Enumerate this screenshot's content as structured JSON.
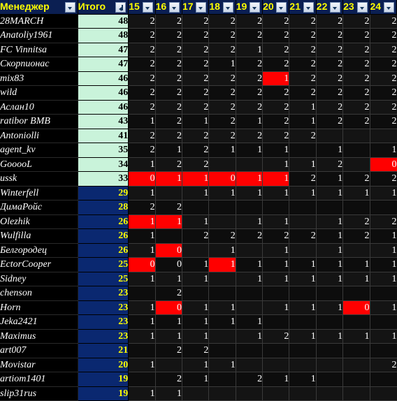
{
  "header": {
    "manager_label": "Менеджер",
    "total_label": "Итого",
    "filter_icon": "chevron-down-icon",
    "sort_icon": "sort-descending-icon",
    "round_columns": [
      "15",
      "16",
      "17",
      "18",
      "19",
      "20",
      "21",
      "22",
      "23",
      "24"
    ]
  },
  "colors": {
    "header_bg": "#0b1f52",
    "header_text": "#ffff00",
    "total_green": "#c9f3da",
    "total_blue": "#0a2870",
    "highlight_red": "#ff0000",
    "body_bg": "#000000"
  },
  "rows": [
    {
      "name": "28MARCH",
      "total": "48",
      "total_style": "green",
      "values": [
        "2",
        "2",
        "2",
        "2",
        "2",
        "2",
        "2",
        "2",
        "2",
        "2"
      ],
      "hot": []
    },
    {
      "name": "Anatoliy1961",
      "total": "48",
      "total_style": "green",
      "values": [
        "2",
        "2",
        "2",
        "2",
        "2",
        "2",
        "2",
        "2",
        "2",
        "2"
      ],
      "hot": []
    },
    {
      "name": "FC Vinnitsa",
      "total": "47",
      "total_style": "green",
      "values": [
        "2",
        "2",
        "2",
        "2",
        "1",
        "2",
        "2",
        "2",
        "2",
        "2"
      ],
      "hot": []
    },
    {
      "name": "Скорпионас",
      "total": "47",
      "total_style": "green",
      "values": [
        "2",
        "2",
        "2",
        "1",
        "2",
        "2",
        "2",
        "2",
        "2",
        "2"
      ],
      "hot": []
    },
    {
      "name": "mix83",
      "total": "46",
      "total_style": "green",
      "values": [
        "2",
        "2",
        "2",
        "2",
        "2",
        "1",
        "2",
        "2",
        "2",
        "2"
      ],
      "hot": [
        5
      ]
    },
    {
      "name": "wild",
      "total": "46",
      "total_style": "green",
      "values": [
        "2",
        "2",
        "2",
        "2",
        "2",
        "2",
        "2",
        "2",
        "2",
        "2"
      ],
      "hot": []
    },
    {
      "name": "Аслан10",
      "total": "46",
      "total_style": "green",
      "values": [
        "2",
        "2",
        "2",
        "2",
        "2",
        "2",
        "1",
        "2",
        "2",
        "2"
      ],
      "hot": []
    },
    {
      "name": "ratibor BMB",
      "total": "43",
      "total_style": "green",
      "values": [
        "1",
        "2",
        "1",
        "2",
        "1",
        "2",
        "1",
        "2",
        "2",
        "2"
      ],
      "hot": []
    },
    {
      "name": "Antoniolli",
      "total": "41",
      "total_style": "green",
      "values": [
        "2",
        "2",
        "2",
        "2",
        "2",
        "2",
        "2",
        "",
        "",
        ""
      ],
      "hot": []
    },
    {
      "name": "agent_kv",
      "total": "35",
      "total_style": "green",
      "values": [
        "2",
        "1",
        "2",
        "1",
        "1",
        "1",
        "",
        "1",
        "",
        "1"
      ],
      "hot": []
    },
    {
      "name": "GooooL",
      "total": "34",
      "total_style": "green",
      "values": [
        "1",
        "2",
        "2",
        "",
        "",
        "1",
        "1",
        "2",
        "",
        "0"
      ],
      "hot": [
        9
      ]
    },
    {
      "name": "ussk",
      "total": "33",
      "total_style": "green",
      "values": [
        "0",
        "1",
        "1",
        "0",
        "1",
        "1",
        "2",
        "1",
        "2",
        "2"
      ],
      "hot": [
        0,
        1,
        2,
        3,
        4,
        5
      ]
    },
    {
      "name": "Winterfell",
      "total": "29",
      "total_style": "blue",
      "values": [
        "1",
        "",
        "1",
        "1",
        "1",
        "1",
        "1",
        "1",
        "1",
        "1"
      ],
      "hot": []
    },
    {
      "name": "ДимаРойс",
      "total": "28",
      "total_style": "blue",
      "values": [
        "2",
        "2",
        "",
        "",
        "",
        "",
        "",
        "",
        "",
        ""
      ],
      "hot": []
    },
    {
      "name": "Olezhik",
      "total": "26",
      "total_style": "blue",
      "values": [
        "1",
        "1",
        "1",
        "",
        "1",
        "1",
        "",
        "1",
        "2",
        "2"
      ],
      "hot": [
        0,
        1
      ]
    },
    {
      "name": "Wulfilla",
      "total": "26",
      "total_style": "blue",
      "values": [
        "1",
        "",
        "2",
        "2",
        "2",
        "2",
        "2",
        "1",
        "2",
        "1"
      ],
      "hot": []
    },
    {
      "name": "Белгородец",
      "total": "26",
      "total_style": "blue",
      "values": [
        "1",
        "0",
        "",
        "1",
        "",
        "1",
        "",
        "1",
        "",
        "1"
      ],
      "hot": [
        1
      ]
    },
    {
      "name": "EctorCooper",
      "total": "25",
      "total_style": "blue",
      "values": [
        "0",
        "0",
        "1",
        "1",
        "1",
        "1",
        "1",
        "1",
        "1",
        "1"
      ],
      "hot": [
        0,
        3
      ]
    },
    {
      "name": "Sidney",
      "total": "25",
      "total_style": "blue",
      "values": [
        "1",
        "1",
        "1",
        "",
        "1",
        "1",
        "1",
        "1",
        "1",
        "1"
      ],
      "hot": []
    },
    {
      "name": "chenson",
      "total": "23",
      "total_style": "blue",
      "values": [
        "",
        "2",
        "",
        "",
        "",
        "",
        "",
        "",
        "",
        ""
      ],
      "hot": []
    },
    {
      "name": "Horn",
      "total": "23",
      "total_style": "blue",
      "values": [
        "1",
        "0",
        "1",
        "1",
        "",
        "1",
        "1",
        "1",
        "0",
        "1"
      ],
      "hot": [
        1,
        8
      ]
    },
    {
      "name": "Jeka2421",
      "total": "23",
      "total_style": "blue",
      "values": [
        "1",
        "1",
        "1",
        "1",
        "1",
        "",
        "",
        "",
        "",
        ""
      ],
      "hot": []
    },
    {
      "name": "Maximus",
      "total": "23",
      "total_style": "blue",
      "values": [
        "1",
        "1",
        "1",
        "",
        "1",
        "2",
        "1",
        "1",
        "1",
        "1"
      ],
      "hot": []
    },
    {
      "name": "art007",
      "total": "21",
      "total_style": "blue",
      "values": [
        "",
        "2",
        "2",
        "",
        "",
        "",
        "",
        "",
        "",
        ""
      ],
      "hot": []
    },
    {
      "name": "Movistar",
      "total": "20",
      "total_style": "blue",
      "values": [
        "1",
        "",
        "1",
        "1",
        "",
        "",
        "",
        "",
        "",
        "2"
      ],
      "hot": []
    },
    {
      "name": "artiom1401",
      "total": "19",
      "total_style": "blue",
      "values": [
        "",
        "2",
        "1",
        "",
        "2",
        "1",
        "1",
        "",
        "",
        ""
      ],
      "hot": []
    },
    {
      "name": "slip31rus",
      "total": "19",
      "total_style": "blue",
      "values": [
        "1",
        "1",
        "",
        "",
        "",
        "",
        "",
        "",
        "",
        ""
      ],
      "hot": []
    }
  ]
}
